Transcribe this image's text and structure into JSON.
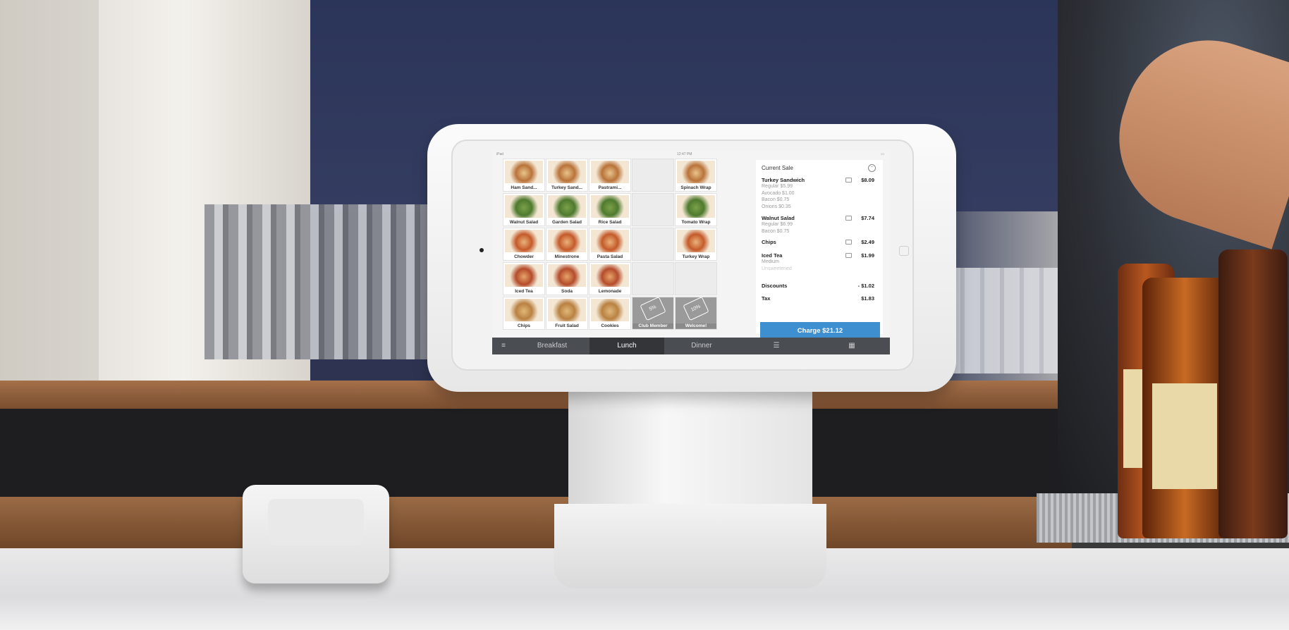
{
  "status_bar": {
    "carrier": "iPad",
    "time": "12:47 PM",
    "battery": ""
  },
  "library": {
    "tiles": [
      {
        "label": "Ham Sand...",
        "type": "item"
      },
      {
        "label": "Turkey Sand...",
        "type": "item"
      },
      {
        "label": "Pastrami...",
        "type": "item"
      },
      {
        "label": "",
        "type": "empty"
      },
      {
        "label": "Spinach Wrap",
        "type": "item"
      },
      {
        "label": "Walnut Salad",
        "type": "item"
      },
      {
        "label": "Garden Salad",
        "type": "item"
      },
      {
        "label": "Rice Salad",
        "type": "item"
      },
      {
        "label": "",
        "type": "empty"
      },
      {
        "label": "Tomato Wrap",
        "type": "item"
      },
      {
        "label": "Chowder",
        "type": "item"
      },
      {
        "label": "Minestrone",
        "type": "item"
      },
      {
        "label": "Pasta Salad",
        "type": "item"
      },
      {
        "label": "",
        "type": "empty"
      },
      {
        "label": "Turkey Wrap",
        "type": "item"
      },
      {
        "label": "Iced Tea",
        "type": "item"
      },
      {
        "label": "Soda",
        "type": "item"
      },
      {
        "label": "Lemonade",
        "type": "item"
      },
      {
        "label": "",
        "type": "empty"
      },
      {
        "label": "",
        "type": "empty"
      },
      {
        "label": "Chips",
        "type": "item"
      },
      {
        "label": "Fruit Salad",
        "type": "item"
      },
      {
        "label": "Cookies",
        "type": "item"
      },
      {
        "label": "Club Member",
        "type": "discount",
        "tag": "5%"
      },
      {
        "label": "Welcome!",
        "type": "discount",
        "tag": "10%"
      }
    ]
  },
  "sale": {
    "title": "Current Sale",
    "items": [
      {
        "name": "Turkey Sandwich",
        "price": "$8.09",
        "modifiers": [
          "Regular $5.99",
          "Avocado $1.00",
          "Bacon $0.75",
          "Onions $0.35"
        ]
      },
      {
        "name": "Walnut Salad",
        "price": "$7.74",
        "modifiers": [
          "Regular $6.99",
          "Bacon $0.75"
        ]
      },
      {
        "name": "Chips",
        "price": "$2.49",
        "modifiers": []
      },
      {
        "name": "Iced Tea",
        "price": "$1.99",
        "modifiers": [
          "Medium",
          "Unsweetened"
        ]
      }
    ],
    "discounts_label": "Discounts",
    "discounts_value": "- $1.02",
    "tax_label": "Tax",
    "tax_value": "$1.83",
    "charge_label": "Charge $21.12"
  },
  "tabs": {
    "menu_icon": "hamburger-icon",
    "breakfast": "Breakfast",
    "lunch": "Lunch",
    "dinner": "Dinner",
    "active": "Lunch",
    "list_icon": "list-icon",
    "grid_icon": "grid-icon"
  },
  "colors": {
    "charge_button": "#3e8fcf",
    "tab_bar": "#4a4d52",
    "tab_active": "#333538"
  }
}
